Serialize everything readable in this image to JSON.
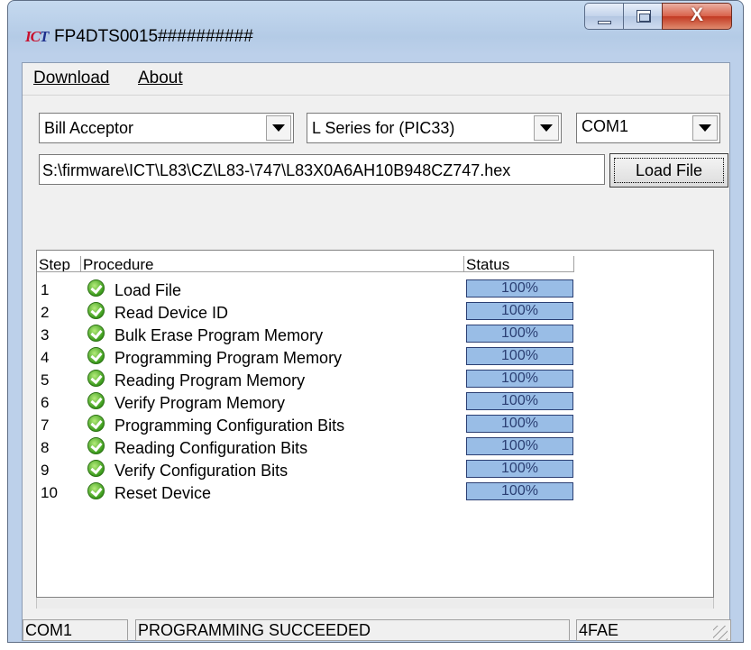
{
  "window": {
    "title": "FP4DTS0015##########",
    "logo_text_a": "IC",
    "logo_text_b": "T",
    "minimize_icon": "minimize-icon",
    "maximize_icon": "maximize-icon",
    "close_glyph": "X"
  },
  "menu": {
    "items": [
      {
        "label": "Download"
      },
      {
        "label": "About"
      }
    ]
  },
  "selectors": {
    "device": "Bill Acceptor",
    "series": "L Series for (PIC33)",
    "port": "COM1"
  },
  "file": {
    "path": "S:\\firmware\\ICT\\L83\\CZ\\L83-\\747\\L83X0A6AH10B948CZ747.hex",
    "load_label": "Load File"
  },
  "list": {
    "columns": {
      "step": "Step",
      "procedure": "Procedure",
      "status": "Status"
    },
    "rows": [
      {
        "step": "1",
        "procedure": "Load File",
        "status": "100%",
        "progress": 1.0
      },
      {
        "step": "2",
        "procedure": "Read Device ID",
        "status": "100%",
        "progress": 1.0
      },
      {
        "step": "3",
        "procedure": "Bulk Erase Program Memory",
        "status": "100%",
        "progress": 1.0
      },
      {
        "step": "4",
        "procedure": "Programming Program Memory",
        "status": "100%",
        "progress": 1.0
      },
      {
        "step": "5",
        "procedure": "Reading Program Memory",
        "status": "100%",
        "progress": 1.0
      },
      {
        "step": "6",
        "procedure": "Verify Program Memory",
        "status": "100%",
        "progress": 1.0
      },
      {
        "step": "7",
        "procedure": "Programming Configuration Bits",
        "status": "100%",
        "progress": 1.0
      },
      {
        "step": "8",
        "procedure": "Reading Configuration Bits",
        "status": "100%",
        "progress": 1.0
      },
      {
        "step": "9",
        "procedure": "Verify Configuration Bits",
        "status": "100%",
        "progress": 1.0
      },
      {
        "step": "10",
        "procedure": "Reset Device",
        "status": "100%",
        "progress": 1.0
      }
    ]
  },
  "status": {
    "port": "COM1",
    "message": "PROGRAMMING SUCCEEDED",
    "checksum": "4FAE"
  }
}
